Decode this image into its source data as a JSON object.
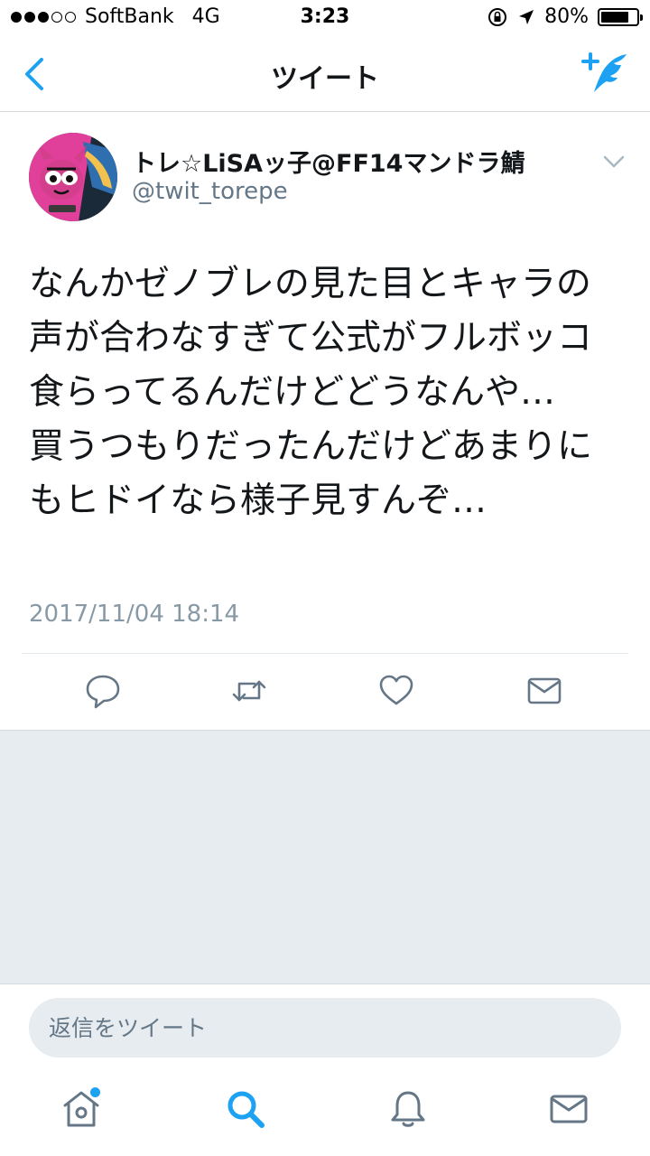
{
  "status_bar": {
    "carrier": "SoftBank",
    "network": "4G",
    "time": "3:23",
    "battery": "80%",
    "battery_level": 0.8,
    "signal_bars_filled": 3,
    "signal_bars_total": 5
  },
  "nav": {
    "title": "ツイート",
    "back_icon": "chevron-left-icon",
    "compose_icon": "compose-tweet-icon"
  },
  "tweet": {
    "display_name": "トレ☆LiSAッ子@FF14マンドラ鯖",
    "handle": "@twit_torepe",
    "text": "なんかゼノブレの見た目とキャラの声が合わなすぎて公式がフルボッコ食らってるんだけどどうなんや…\n買うつもりだったんだけどあまりにもヒドイなら様子見すんぞ…",
    "date": "2017/11/04 18:14",
    "actions": [
      "reply-icon",
      "retweet-icon",
      "like-icon",
      "direct-message-icon"
    ]
  },
  "reply": {
    "placeholder": "返信をツイート"
  },
  "tabs": [
    "home-icon",
    "search-icon",
    "notifications-icon",
    "messages-icon"
  ],
  "colors": {
    "accent": "#1da1f2",
    "icon_gray": "#657786",
    "background_gray": "#e6ecf0"
  }
}
